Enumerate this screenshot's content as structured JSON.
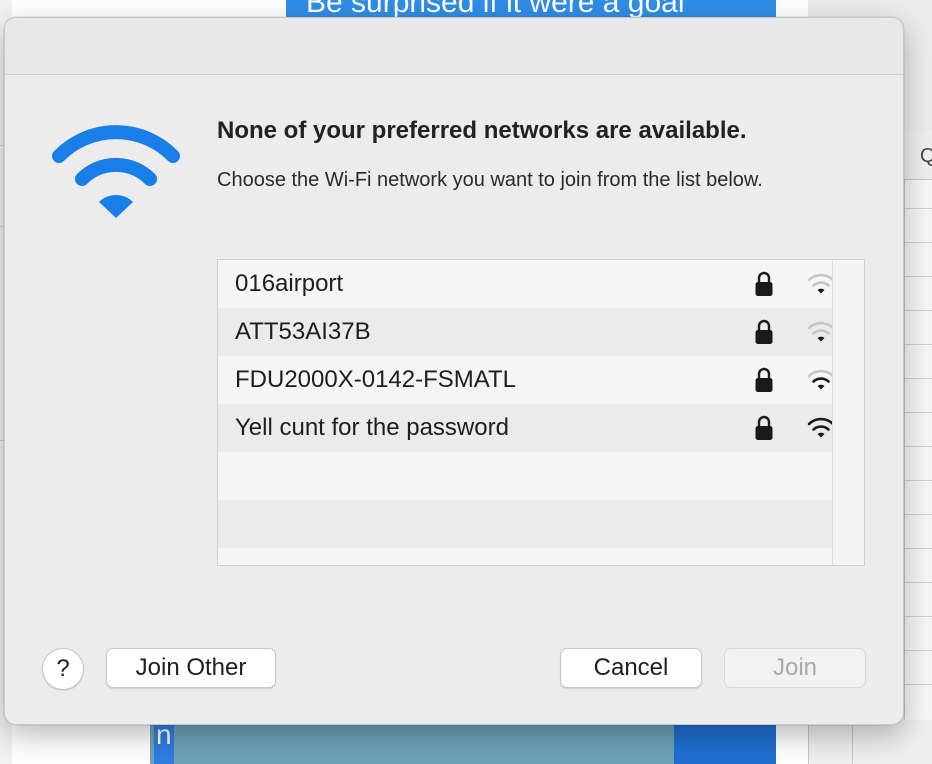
{
  "background": {
    "banner_text": "Be surprised if it were a goal",
    "right_header_text": "Q",
    "bottom_tag_text": "n"
  },
  "dialog": {
    "headline": "None of your preferred networks are available.",
    "subtext": "Choose the Wi-Fi network you want to join from the list below.",
    "icon": "wifi-icon",
    "accent_color": "#1a7ee8"
  },
  "networks": [
    {
      "name": "016airport",
      "secured": true,
      "signal_bars": 1,
      "icon": "lock-icon"
    },
    {
      "name": "ATT53AI37B",
      "secured": true,
      "signal_bars": 1,
      "icon": "lock-icon"
    },
    {
      "name": "FDU2000X-0142-FSMATL",
      "secured": true,
      "signal_bars": 2,
      "icon": "lock-icon"
    },
    {
      "name": "Yell cunt for the password",
      "secured": true,
      "signal_bars": 3,
      "icon": "lock-icon"
    }
  ],
  "buttons": {
    "help_label": "?",
    "join_other_label": "Join Other",
    "cancel_label": "Cancel",
    "join_label": "Join",
    "join_enabled": false
  }
}
